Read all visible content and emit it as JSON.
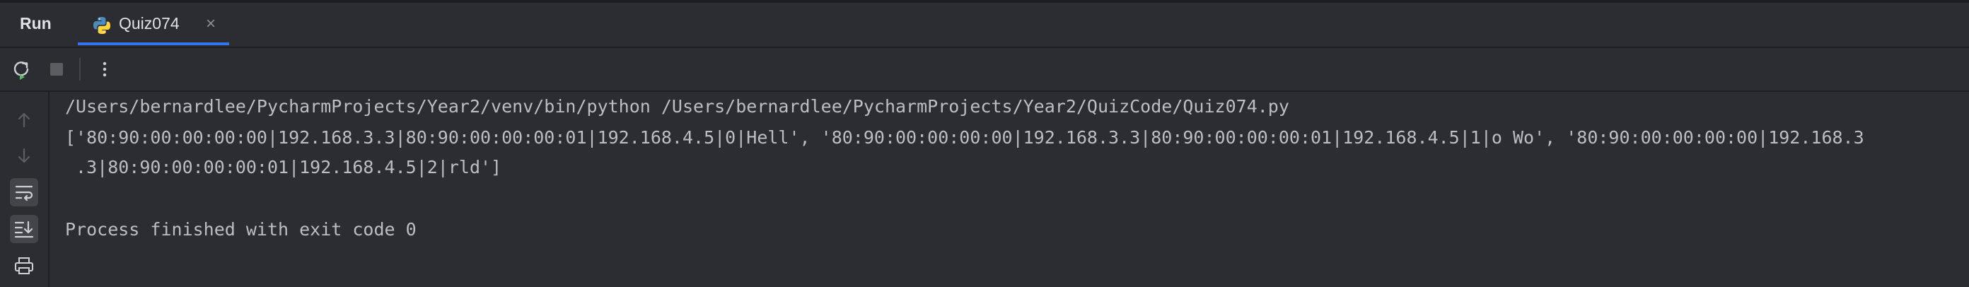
{
  "panel": {
    "run_label": "Run",
    "tab_title": "Quiz074",
    "tab_close": "×"
  },
  "console": {
    "command_line": "/Users/bernardlee/PycharmProjects/Year2/venv/bin/python /Users/bernardlee/PycharmProjects/Year2/QuizCode/Quiz074.py",
    "output_line_1": "['80:90:00:00:00:00|192.168.3.3|80:90:00:00:00:01|192.168.4.5|0|Hell', '80:90:00:00:00:00|192.168.3.3|80:90:00:00:00:01|192.168.4.5|1|o Wo', '80:90:00:00:00:00|192.168.3",
    "output_line_2": " .3|80:90:00:00:00:01|192.168.4.5|2|rld']",
    "exit_message": "Process finished with exit code 0"
  },
  "icons": {
    "tab_icon": "python-icon",
    "toolbar": [
      "rerun-icon",
      "stop-icon",
      "more-options-icon"
    ],
    "gutter": [
      "scroll-up-icon",
      "scroll-down-icon",
      "soft-wrap-icon",
      "scroll-to-end-icon",
      "print-icon"
    ]
  },
  "colors": {
    "background": "#2b2d30",
    "text": "#bcbec4",
    "tab_underline": "#3574f0",
    "rerun_green": "#5fb865"
  }
}
